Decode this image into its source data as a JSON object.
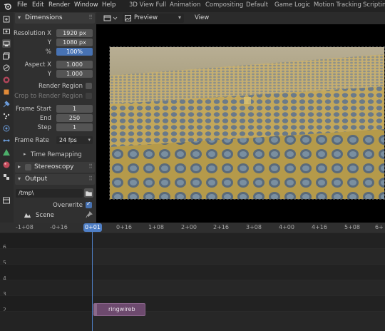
{
  "top_menu": {
    "items": [
      "File",
      "Edit",
      "Render",
      "Window",
      "Help"
    ],
    "workspaces": [
      "3D View Full",
      "Animation",
      "Compositing",
      "Default",
      "Game Logic",
      "Motion Tracking",
      "Scripting"
    ]
  },
  "properties": {
    "dimensions_header": "Dimensions",
    "resolution_x_label": "Resolution X",
    "resolution_x": "1920 px",
    "resolution_y_label": "Y",
    "resolution_y": "1080 px",
    "percent_label": "%",
    "percent": "100%",
    "aspect_x_label": "Aspect X",
    "aspect_x": "1.000",
    "aspect_y_label": "Y",
    "aspect_y": "1.000",
    "render_region": "Render Region",
    "crop_region": "Crop to Render Region",
    "frame_start_label": "Frame Start",
    "frame_start": "1",
    "frame_end_label": "End",
    "frame_end": "250",
    "frame_step_label": "Step",
    "frame_step": "1",
    "frame_rate_label": "Frame Rate",
    "frame_rate": "24 fps",
    "time_remapping": "Time Remapping",
    "stereoscopy": "Stereoscopy",
    "output_header": "Output",
    "output_path": "/tmp\\",
    "overwrite": "Overwrite",
    "overwrite_checked": true,
    "scene_label": "Scene"
  },
  "preview": {
    "mode": "Preview",
    "view_menu": "View"
  },
  "timeline": {
    "current_frame": "0+01",
    "ticks": [
      "-1+08",
      "-0+16",
      "0+16",
      "1+08",
      "2+00",
      "2+16",
      "3+08",
      "4+00",
      "4+16",
      "5+08",
      "6+"
    ],
    "channels": [
      "6",
      "5",
      "4",
      "3",
      "2"
    ],
    "strip_name": "ringwireb"
  },
  "colors": {
    "accent": "#4772b3",
    "playhead": "#4f7fc6",
    "strip": "#6d4a6e"
  },
  "icons": [
    "blender-logo-icon",
    "tool-icon",
    "render-icon",
    "output-icon",
    "view-layer-icon",
    "scene-icon",
    "world-icon",
    "object-icon",
    "modifier-icon",
    "particles-icon",
    "physics-icon",
    "constraints-icon",
    "data-icon",
    "material-icon",
    "texture-icon",
    "folder-icon",
    "pin-icon"
  ]
}
